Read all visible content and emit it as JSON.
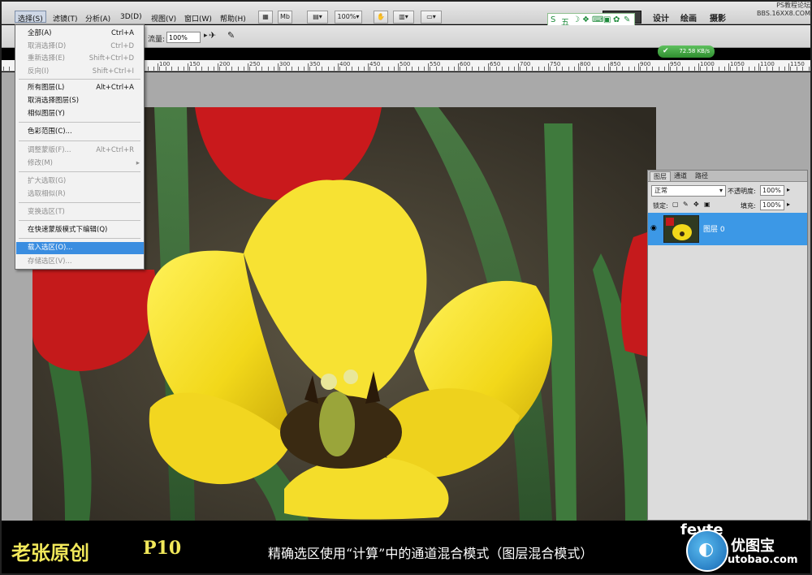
{
  "menubar": {
    "items": [
      "选择(S)",
      "滤镜(T)",
      "分析(A)",
      "3D(D)",
      "视图(V)",
      "窗口(W)",
      "帮助(H)"
    ],
    "zoom": "100%",
    "workspaces": [
      "设计",
      "绘画",
      "摄影"
    ],
    "site_watermark": [
      "PS教程论坛",
      "BBS.16XX8.COM"
    ],
    "mb_label": "Mb"
  },
  "ime": {
    "glyphs": [
      "S",
      "五",
      "☽",
      "❖",
      "⌨",
      "▣",
      "✿",
      "✎"
    ]
  },
  "options": {
    "flow_label": "流量:",
    "flow_value": "100%"
  },
  "speed": "72.58 KB/s",
  "ruler": {
    "labels": [
      "100",
      "150",
      "200",
      "250",
      "300",
      "350",
      "400",
      "450",
      "500",
      "550",
      "600",
      "650",
      "700",
      "750",
      "800",
      "850",
      "900",
      "950",
      "1000",
      "1050",
      "1100",
      "1150"
    ]
  },
  "select_menu": {
    "items": [
      {
        "label": "全部(A)",
        "shortcut": "Ctrl+A",
        "disabled": false
      },
      {
        "label": "取消选择(D)",
        "shortcut": "Ctrl+D",
        "disabled": true
      },
      {
        "label": "重新选择(E)",
        "shortcut": "Shift+Ctrl+D",
        "disabled": true
      },
      {
        "label": "反向(I)",
        "shortcut": "Shift+Ctrl+I",
        "disabled": true
      },
      {
        "label": "所有图层(L)",
        "shortcut": "Alt+Ctrl+A",
        "disabled": false
      },
      {
        "label": "取消选择图层(S)",
        "shortcut": "",
        "disabled": false
      },
      {
        "label": "相似图层(Y)",
        "shortcut": "",
        "disabled": false
      },
      {
        "label": "色彩范围(C)...",
        "shortcut": "",
        "disabled": false
      },
      {
        "label": "调整蒙版(F)...",
        "shortcut": "Alt+Ctrl+R",
        "disabled": true
      },
      {
        "label": "修改(M)",
        "shortcut": "",
        "disabled": true
      },
      {
        "label": "扩大选取(G)",
        "shortcut": "",
        "disabled": true
      },
      {
        "label": "选取相似(R)",
        "shortcut": "",
        "disabled": true
      },
      {
        "label": "变换选区(T)",
        "shortcut": "",
        "disabled": true
      },
      {
        "label": "在快速蒙版模式下编辑(Q)",
        "shortcut": "",
        "disabled": false
      },
      {
        "label": "载入选区(O)...",
        "shortcut": "",
        "disabled": false
      },
      {
        "label": "存储选区(V)...",
        "shortcut": "",
        "disabled": true
      }
    ],
    "submenu_arrow": "▸"
  },
  "layers": {
    "tabs": [
      "图层",
      "通道",
      "路径"
    ],
    "blend_mode": "正常",
    "opacity_label": "不透明度:",
    "opacity_value": "100%",
    "lock_label": "锁定:",
    "fill_label": "填充:",
    "fill_value": "100%",
    "layer_name": "图层 0"
  },
  "footer": {
    "author": "老张原创",
    "page": "P10",
    "caption": "精确选区使用“计算”中的通道混合模式（图层混合模式）",
    "logo_text": "优图宝",
    "logo_url": "utobao.com",
    "fevte": "fevte"
  },
  "colors": {
    "menu_highlight": "#3a8de0",
    "layer_selected": "#3c98e6",
    "footer_yellow": "#f1e85a"
  }
}
